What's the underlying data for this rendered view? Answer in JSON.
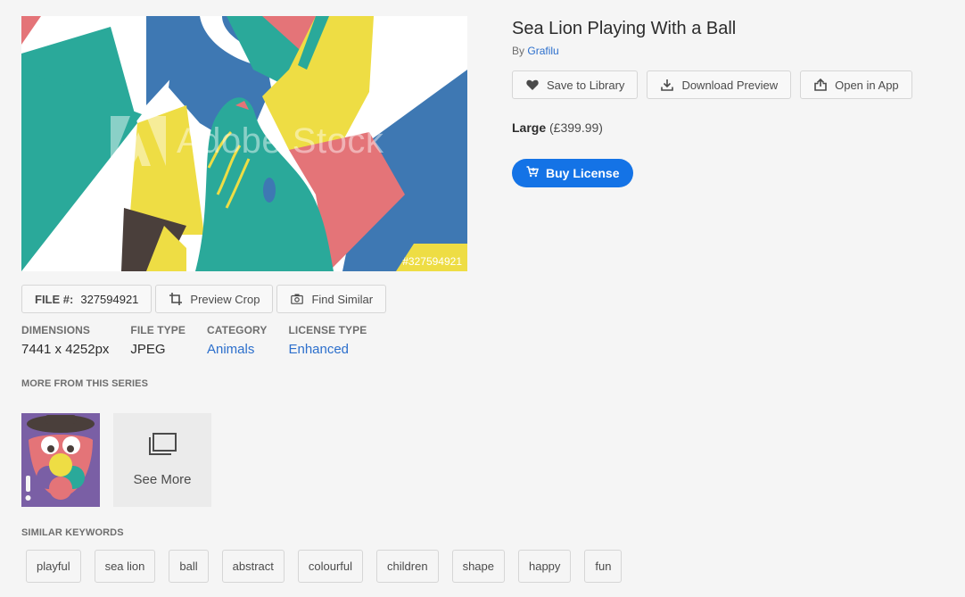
{
  "asset": {
    "title": "Sea Lion Playing With a Ball",
    "by_prefix": "By",
    "author": "Grafilu",
    "watermark": "Adobe Stock",
    "file_id_overlay": "#327594921"
  },
  "top_actions": {
    "save": "Save to Library",
    "download": "Download Preview",
    "open": "Open in App"
  },
  "license": {
    "size_label": "Large",
    "price": "(£399.99)",
    "buy_label": "Buy License"
  },
  "file_actions": {
    "file_key": "FILE #:",
    "file_value": "327594921",
    "preview_crop": "Preview Crop",
    "find_similar": "Find Similar"
  },
  "meta": [
    {
      "heading": "DIMENSIONS",
      "value": "7441 x 4252px",
      "link": false
    },
    {
      "heading": "FILE TYPE",
      "value": "JPEG",
      "link": false
    },
    {
      "heading": "CATEGORY",
      "value": "Animals",
      "link": true
    },
    {
      "heading": "LICENSE TYPE",
      "value": "Enhanced",
      "link": true
    }
  ],
  "series": {
    "label": "MORE FROM THIS SERIES",
    "see_more": "See More"
  },
  "keywords": {
    "label": "SIMILAR KEYWORDS",
    "items": [
      "playful",
      "sea lion",
      "ball",
      "abstract",
      "colourful",
      "children",
      "shape",
      "happy",
      "fun"
    ]
  },
  "colors": {
    "teal": "#2aa99a",
    "blue": "#3e78b3",
    "yellow": "#eedd44",
    "pink": "#e47478",
    "dark": "#4a3f3b",
    "accent": "#1473e6",
    "link": "#2c6fcc"
  }
}
